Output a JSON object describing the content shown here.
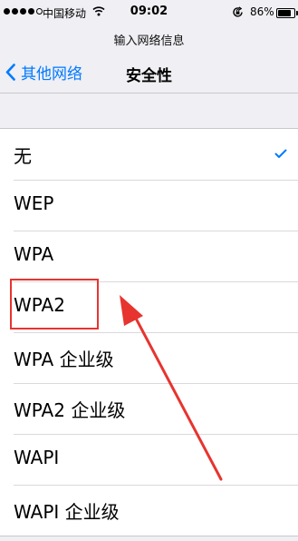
{
  "status_bar": {
    "carrier": "中国移动",
    "time": "09:02",
    "battery_percent": "86%",
    "battery_level": 0.86
  },
  "header": {
    "subtitle": "输入网络信息",
    "back_label": "其他网络",
    "title": "安全性"
  },
  "security_options": [
    {
      "label": "无",
      "selected": true
    },
    {
      "label": "WEP",
      "selected": false
    },
    {
      "label": "WPA",
      "selected": false
    },
    {
      "label": "WPA2",
      "selected": false
    },
    {
      "label": "WPA 企业级",
      "selected": false
    },
    {
      "label": "WPA2 企业级",
      "selected": false
    },
    {
      "label": "WAPI",
      "selected": false
    },
    {
      "label": "WAPI 企业级",
      "selected": false
    }
  ],
  "colors": {
    "accent": "#007aff",
    "annotation": "#e7342f",
    "background": "#efeff4"
  },
  "icons": [
    "signal-dots-icon",
    "wifi-icon",
    "orientation-lock-icon",
    "battery-icon",
    "chevron-left-icon",
    "checkmark-icon",
    "annotation-arrow"
  ]
}
